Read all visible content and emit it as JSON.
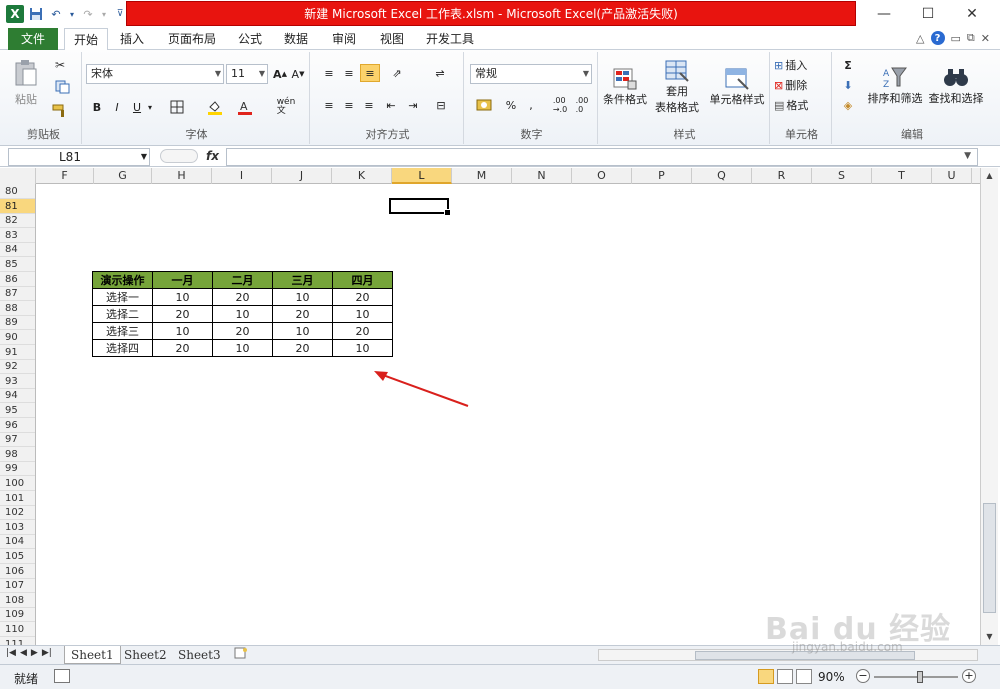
{
  "window": {
    "title": "新建 Microsoft Excel 工作表.xlsm  -  Microsoft Excel(产品激活失败)",
    "controls": [
      "—",
      "☐",
      "✕"
    ]
  },
  "ribbon_tabs": {
    "file": "文件",
    "tabs": [
      "开始",
      "插入",
      "页面布局",
      "公式",
      "数据",
      "审阅",
      "视图",
      "开发工具"
    ],
    "active": "开始"
  },
  "clipboard": {
    "paste": "粘贴",
    "label": "剪贴板"
  },
  "font": {
    "name": "宋体",
    "size": "11",
    "label": "字体",
    "bold": "B",
    "italic": "I",
    "underline": "U",
    "wen": "wén\n文"
  },
  "alignment": {
    "label": "对齐方式"
  },
  "number": {
    "format": "常规",
    "label": "数字",
    "percent": "%",
    "comma": ",",
    "inc_dec": ".00\n→.0",
    "dec_dec": ".00\n.0"
  },
  "styles": {
    "conditional": "条件格式",
    "table1": "套用",
    "table2": "表格格式",
    "cell_style": "单元格样式",
    "label": "样式"
  },
  "cells": {
    "insert": "插入",
    "delete": "删除",
    "format": "格式",
    "label": "单元格"
  },
  "editing": {
    "sort": "排序和筛选",
    "find": "查找和选择",
    "label": "编辑",
    "sigma": "Σ"
  },
  "formula_bar": {
    "name_box": "L81",
    "fx": "fx",
    "value": ""
  },
  "columns": [
    "F",
    "G",
    "H",
    "I",
    "J",
    "K",
    "L",
    "M",
    "N",
    "O",
    "P",
    "Q",
    "R",
    "S",
    "T",
    "U"
  ],
  "selected_column": "L",
  "rows": [
    "80",
    "81",
    "82",
    "83",
    "84",
    "85",
    "86",
    "87",
    "88",
    "89",
    "90",
    "91",
    "92",
    "93",
    "94",
    "95",
    "96",
    "97",
    "98",
    "99",
    "100",
    "101",
    "102",
    "103",
    "104",
    "105",
    "106",
    "107",
    "108",
    "109",
    "110",
    "111"
  ],
  "selected_row": "81",
  "data_table": {
    "headers": [
      "演示操作",
      "一月",
      "二月",
      "三月",
      "四月"
    ],
    "rows": [
      [
        "选择一",
        "10",
        "20",
        "10",
        "20"
      ],
      [
        "选择二",
        "20",
        "10",
        "20",
        "10"
      ],
      [
        "选择三",
        "10",
        "20",
        "10",
        "20"
      ],
      [
        "选择四",
        "20",
        "10",
        "20",
        "10"
      ]
    ],
    "header_color": "#76a43a"
  },
  "annotation": {
    "arrow_color": "#d9201c"
  },
  "sheet_tabs": [
    "Sheet1",
    "Sheet2",
    "Sheet3"
  ],
  "active_sheet": "Sheet1",
  "status": {
    "ready": "就绪",
    "zoom": "90%",
    "zoom_fraction": 0.55
  },
  "watermark": {
    "brand": "Bai du 经验",
    "site": "jingyan.baidu.com"
  }
}
